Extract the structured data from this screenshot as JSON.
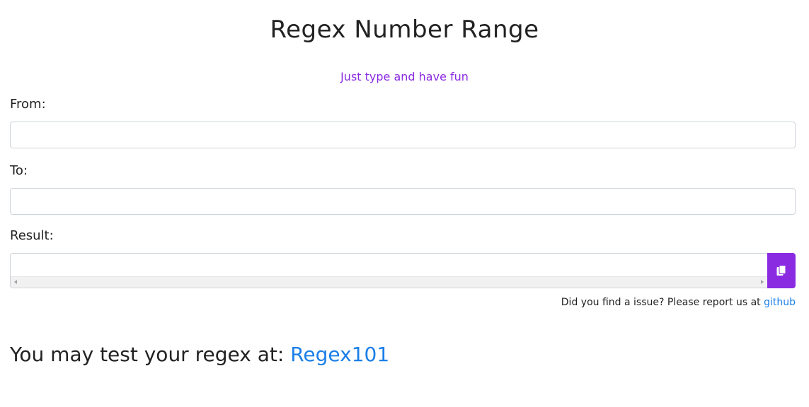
{
  "header": {
    "title": "Regex Number Range",
    "subtitle": "Just type and have fun"
  },
  "form": {
    "from_label": "From:",
    "from_value": "",
    "to_label": "To:",
    "to_value": "",
    "result_label": "Result:",
    "result_value": ""
  },
  "copy_button": {
    "icon": "copy-icon"
  },
  "footer": {
    "issue_text": "Did you find a issue? Please report us at",
    "github_link": "github",
    "test_text": "You may test your regex at:",
    "regex101_link": "Regex101"
  },
  "colors": {
    "accent": "#8a2be2",
    "link": "#1a7fe8"
  }
}
